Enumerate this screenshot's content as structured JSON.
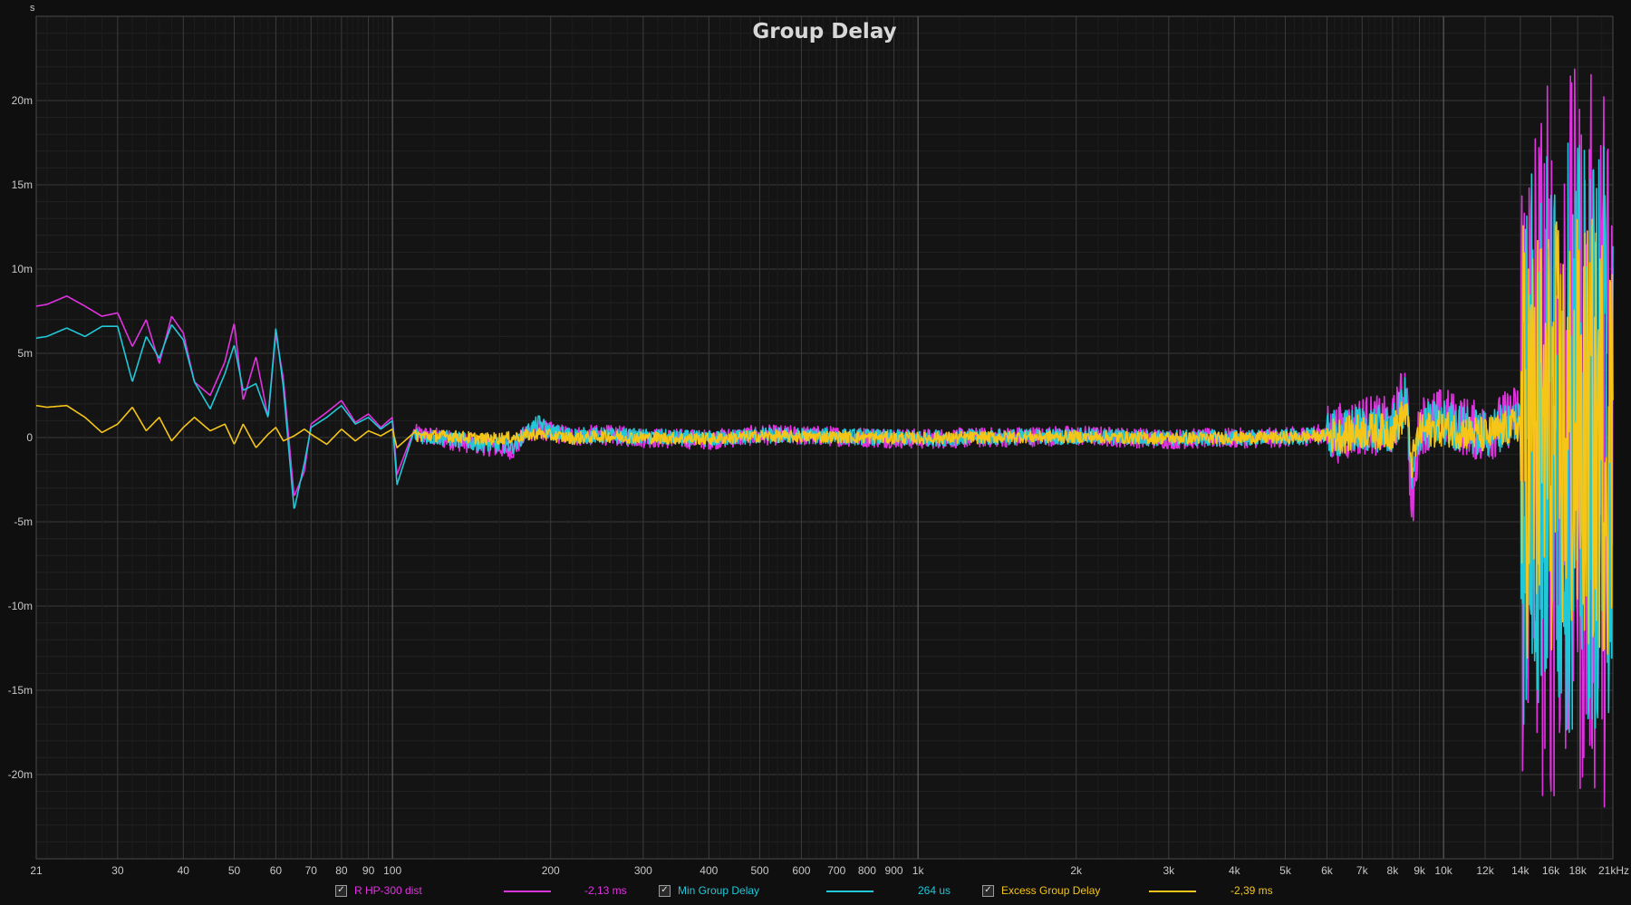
{
  "chart_data": {
    "type": "line",
    "title": "Group Delay",
    "y_unit_label": "s",
    "x_scale": "log",
    "xlim": [
      21,
      21000
    ],
    "ylim": [
      -0.025,
      0.025
    ],
    "x_ticks": [
      {
        "v": 21,
        "label": "21"
      },
      {
        "v": 30,
        "label": "30"
      },
      {
        "v": 40,
        "label": "40"
      },
      {
        "v": 50,
        "label": "50"
      },
      {
        "v": 60,
        "label": "60"
      },
      {
        "v": 70,
        "label": "70"
      },
      {
        "v": 80,
        "label": "80"
      },
      {
        "v": 90,
        "label": "90"
      },
      {
        "v": 100,
        "label": "100"
      },
      {
        "v": 200,
        "label": "200"
      },
      {
        "v": 300,
        "label": "300"
      },
      {
        "v": 400,
        "label": "400"
      },
      {
        "v": 500,
        "label": "500"
      },
      {
        "v": 600,
        "label": "600"
      },
      {
        "v": 700,
        "label": "700"
      },
      {
        "v": 800,
        "label": "800"
      },
      {
        "v": 900,
        "label": "900"
      },
      {
        "v": 1000,
        "label": "1k"
      },
      {
        "v": 2000,
        "label": "2k"
      },
      {
        "v": 3000,
        "label": "3k"
      },
      {
        "v": 4000,
        "label": "4k"
      },
      {
        "v": 5000,
        "label": "5k"
      },
      {
        "v": 6000,
        "label": "6k"
      },
      {
        "v": 7000,
        "label": "7k"
      },
      {
        "v": 8000,
        "label": "8k"
      },
      {
        "v": 9000,
        "label": "9k"
      },
      {
        "v": 10000,
        "label": "10k"
      },
      {
        "v": 12000,
        "label": "12k"
      },
      {
        "v": 14000,
        "label": "14k"
      },
      {
        "v": 16000,
        "label": "16k"
      },
      {
        "v": 18000,
        "label": "18k"
      },
      {
        "v": 21000,
        "label": "21kHz"
      }
    ],
    "y_ticks": [
      {
        "v": 0.02,
        "label": "20m"
      },
      {
        "v": 0.015,
        "label": "15m"
      },
      {
        "v": 0.01,
        "label": "10m"
      },
      {
        "v": 0.005,
        "label": "5m"
      },
      {
        "v": 0,
        "label": "0"
      },
      {
        "v": -0.005,
        "label": "-5m"
      },
      {
        "v": -0.01,
        "label": "-10m"
      },
      {
        "v": -0.015,
        "label": "-15m"
      },
      {
        "v": -0.02,
        "label": "-20m"
      }
    ],
    "grid": true,
    "legend_position": "bottom",
    "series": [
      {
        "name": "R HP-300 dist",
        "color": "#e033e0",
        "value_label": "-2,13 ms",
        "x": [
          21,
          22,
          24,
          26,
          28,
          30,
          32,
          34,
          36,
          38,
          40,
          42,
          45,
          48,
          50,
          52,
          55,
          58,
          60,
          62,
          65,
          68,
          70,
          75,
          80,
          85,
          90,
          95,
          100,
          102,
          110,
          130,
          150,
          170,
          180,
          190,
          200,
          220,
          250,
          300,
          400,
          500,
          700,
          1000,
          1500,
          2000,
          3000,
          5000,
          6500,
          7000,
          8000,
          8500,
          8700,
          9000,
          10000,
          12000,
          14000,
          15000,
          16000,
          18000,
          21000
        ],
        "y": [
          0.0078,
          0.0079,
          0.0084,
          0.0078,
          0.0072,
          0.0074,
          0.0054,
          0.007,
          0.0044,
          0.0072,
          0.0062,
          0.0033,
          0.0025,
          0.0045,
          0.0068,
          0.0022,
          0.0048,
          0.0012,
          0.0062,
          0.0035,
          -0.0035,
          -0.002,
          0.0008,
          0.0015,
          0.0022,
          0.0009,
          0.0014,
          0.0006,
          0.0012,
          -0.0022,
          0.0005,
          -0.0004,
          -0.0012,
          -0.0018,
          0.0008,
          0.0012,
          0.0008,
          0.0002,
          0.0004,
          0.0,
          -0.0003,
          0.0004,
          0.0002,
          -0.0002,
          0.0001,
          0.0003,
          -0.0002,
          0.0,
          0.0008,
          0.002,
          0.0015,
          0.008,
          -0.012,
          0.002,
          0.003,
          0.0005,
          0.004,
          0.02,
          -0.02,
          0.015,
          0.02
        ]
      },
      {
        "name": "Min Group Delay",
        "color": "#20c8d8",
        "value_label": "264 us",
        "x": [
          21,
          22,
          24,
          26,
          28,
          30,
          32,
          34,
          36,
          38,
          40,
          42,
          45,
          48,
          50,
          52,
          55,
          58,
          60,
          62,
          65,
          68,
          70,
          75,
          80,
          85,
          90,
          95,
          100,
          102,
          110,
          130,
          150,
          170,
          180,
          190,
          200,
          220,
          250,
          300,
          400,
          500,
          700,
          1000,
          1500,
          2000,
          3000,
          5000,
          6500,
          7000,
          8000,
          8500,
          8700,
          9000,
          10000,
          12000,
          14000,
          15000,
          16000,
          18000,
          21000
        ],
        "y": [
          0.0059,
          0.006,
          0.0065,
          0.006,
          0.0066,
          0.0066,
          0.0033,
          0.006,
          0.0047,
          0.0067,
          0.0058,
          0.0033,
          0.0017,
          0.0038,
          0.0055,
          0.0028,
          0.0032,
          0.0012,
          0.0065,
          0.003,
          -0.0043,
          -0.0015,
          0.0006,
          0.0012,
          0.0019,
          0.0008,
          0.0012,
          0.0005,
          0.001,
          -0.0028,
          0.0004,
          -0.0002,
          -0.001,
          -0.0012,
          0.0008,
          0.0022,
          0.0008,
          0.0003,
          0.0003,
          0.0001,
          -0.0002,
          0.0003,
          0.0002,
          -0.0001,
          0.0001,
          0.0002,
          -0.0001,
          0.0,
          0.0006,
          0.0015,
          0.001,
          0.006,
          -0.008,
          0.0015,
          0.0022,
          0.0004,
          0.003,
          0.022,
          -0.022,
          0.02,
          0.024
        ]
      },
      {
        "name": "Excess Group Delay",
        "color": "#f5c518",
        "value_label": "-2,39 ms",
        "x": [
          21,
          22,
          24,
          26,
          28,
          30,
          32,
          34,
          36,
          38,
          40,
          42,
          45,
          48,
          50,
          52,
          55,
          58,
          60,
          62,
          65,
          68,
          70,
          75,
          80,
          85,
          90,
          95,
          100,
          102,
          110,
          130,
          150,
          170,
          180,
          190,
          200,
          220,
          250,
          300,
          400,
          500,
          700,
          1000,
          1500,
          2000,
          3000,
          5000,
          6500,
          7000,
          8000,
          8500,
          8700,
          9000,
          10000,
          12000,
          14000,
          15000,
          16000,
          18000,
          21000
        ],
        "y": [
          0.0019,
          0.0018,
          0.0019,
          0.0012,
          0.0003,
          0.0008,
          0.0018,
          0.0004,
          0.0012,
          -0.0002,
          0.0006,
          0.0012,
          0.0004,
          0.0008,
          -0.0004,
          0.0008,
          -0.0006,
          0.0002,
          0.0006,
          -0.0002,
          0.0001,
          0.0005,
          0.0002,
          -0.0004,
          0.0005,
          -0.0002,
          0.0004,
          0.0001,
          0.0005,
          -0.0006,
          0.0003,
          0.0002,
          -0.0002,
          0.0,
          0.0003,
          0.0006,
          0.0003,
          -0.0001,
          0.0002,
          0.0,
          -0.0002,
          0.0002,
          0.0001,
          -0.0001,
          0.0001,
          0.0001,
          -0.0001,
          0.0,
          0.0004,
          0.001,
          0.0008,
          0.004,
          -0.004,
          0.001,
          0.0014,
          0.0003,
          0.002,
          0.012,
          -0.012,
          0.014,
          0.016
        ]
      }
    ]
  }
}
